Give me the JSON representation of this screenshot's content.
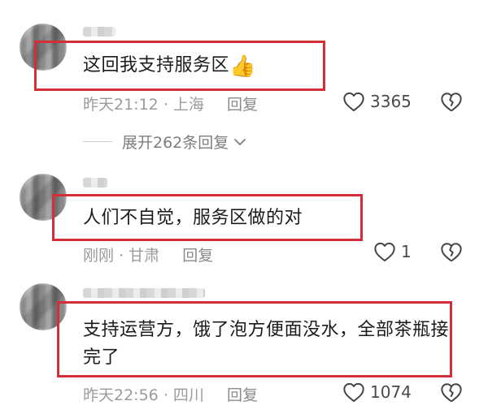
{
  "comments": [
    {
      "text": "这回我支持服务区",
      "emoji": "👍",
      "time": "昨天21:12",
      "location": "上海",
      "reply_label": "回复",
      "likes": "3365"
    },
    {
      "text": "人们不自觉，服务区做的对",
      "time": "刚刚",
      "location": "甘肃",
      "reply_label": "回复",
      "likes": "1"
    },
    {
      "text": "支持运营方，饿了泡方便面没水，全部茶瓶接完了",
      "time": "昨天22:56",
      "location": "四川",
      "reply_label": "回复",
      "likes": "1074"
    }
  ],
  "expand_replies": "展开262条回复",
  "separator": "·",
  "colors": {
    "highlight_border": "#d32f3a",
    "meta_text": "#9b9b9b"
  }
}
